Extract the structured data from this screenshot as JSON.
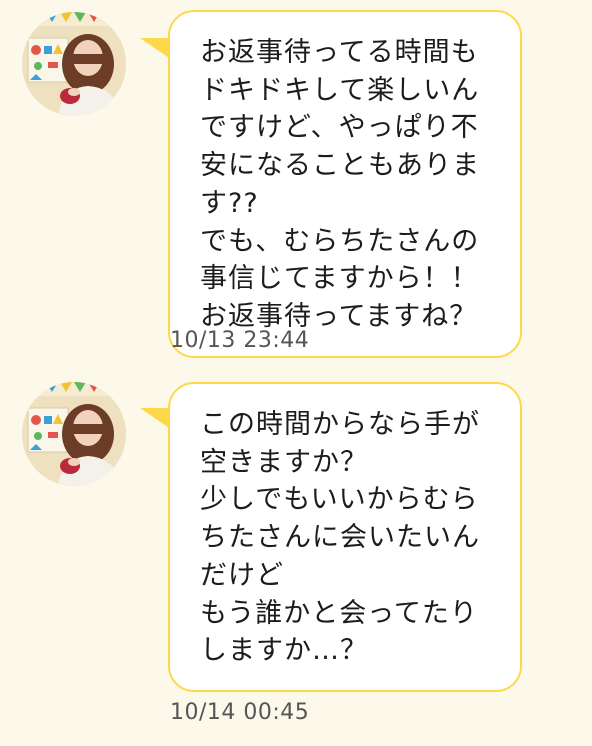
{
  "colors": {
    "background": "#fdf9ea",
    "bubble_fill": "#ffffff",
    "bubble_border": "#ffd84a",
    "timestamp": "#555555"
  },
  "messages": [
    {
      "avatar": "sender-avatar-photo",
      "text": "お返事待ってる時間もドキドキして楽しいんですけど、やっぱり不安になることもあります??\nでも、むらちたさんの事信じてますから！！\nお返事待ってますね？",
      "timestamp": "10/13 23:44"
    },
    {
      "avatar": "sender-avatar-photo",
      "text": "この時間からなら手が空きますか？\n少しでもいいからむらちたさんに会いたいんだけど\nもう誰かと会ってたりしますか…？",
      "timestamp": "10/14 00:45"
    }
  ]
}
